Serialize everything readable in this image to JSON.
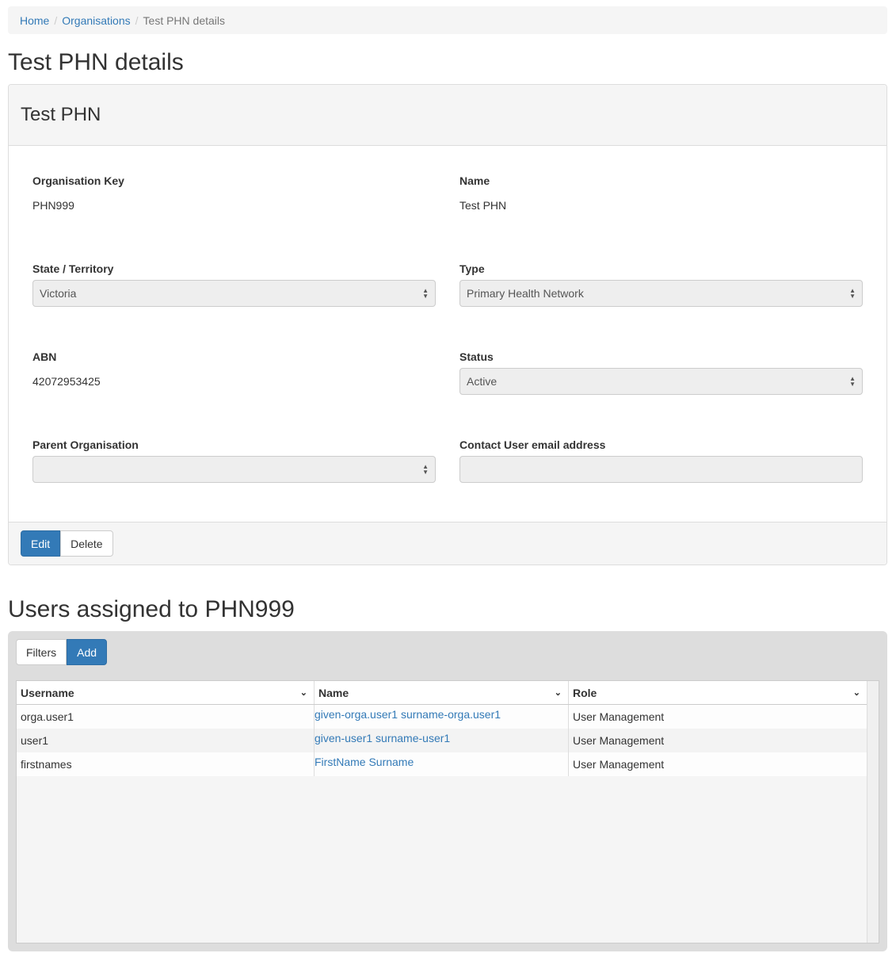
{
  "breadcrumb": {
    "home": "Home",
    "organisations": "Organisations",
    "current": "Test PHN details",
    "separator": "/"
  },
  "page_title": "Test PHN details",
  "panel": {
    "title": "Test PHN",
    "fields": {
      "org_key": {
        "label": "Organisation Key",
        "value": "PHN999"
      },
      "name": {
        "label": "Name",
        "value": "Test PHN"
      },
      "state": {
        "label": "State / Territory",
        "value": "Victoria"
      },
      "type": {
        "label": "Type",
        "value": "Primary Health Network"
      },
      "abn": {
        "label": "ABN",
        "value": "42072953425"
      },
      "status": {
        "label": "Status",
        "value": "Active"
      },
      "parent": {
        "label": "Parent Organisation",
        "value": ""
      },
      "contact": {
        "label": "Contact User email address",
        "value": ""
      }
    },
    "edit_label": "Edit",
    "delete_label": "Delete"
  },
  "users_section": {
    "title": "Users assigned to PHN999",
    "filters_label": "Filters",
    "add_label": "Add",
    "columns": [
      "Username",
      "Name",
      "Role"
    ],
    "rows": [
      {
        "username": "orga.user1",
        "name": "given-orga.user1 surname-orga.user1",
        "role": "User Management"
      },
      {
        "username": "user1",
        "name": "given-user1 surname-user1",
        "role": "User Management"
      },
      {
        "username": "firstnames",
        "name": "FirstName Surname",
        "role": "User Management"
      }
    ]
  },
  "icons": {
    "select_arrows": "up-down-arrows-icon",
    "column_sort": "chevron-down-icon"
  },
  "colors": {
    "link": "#337ab7",
    "primary_button": "#337ab7"
  }
}
